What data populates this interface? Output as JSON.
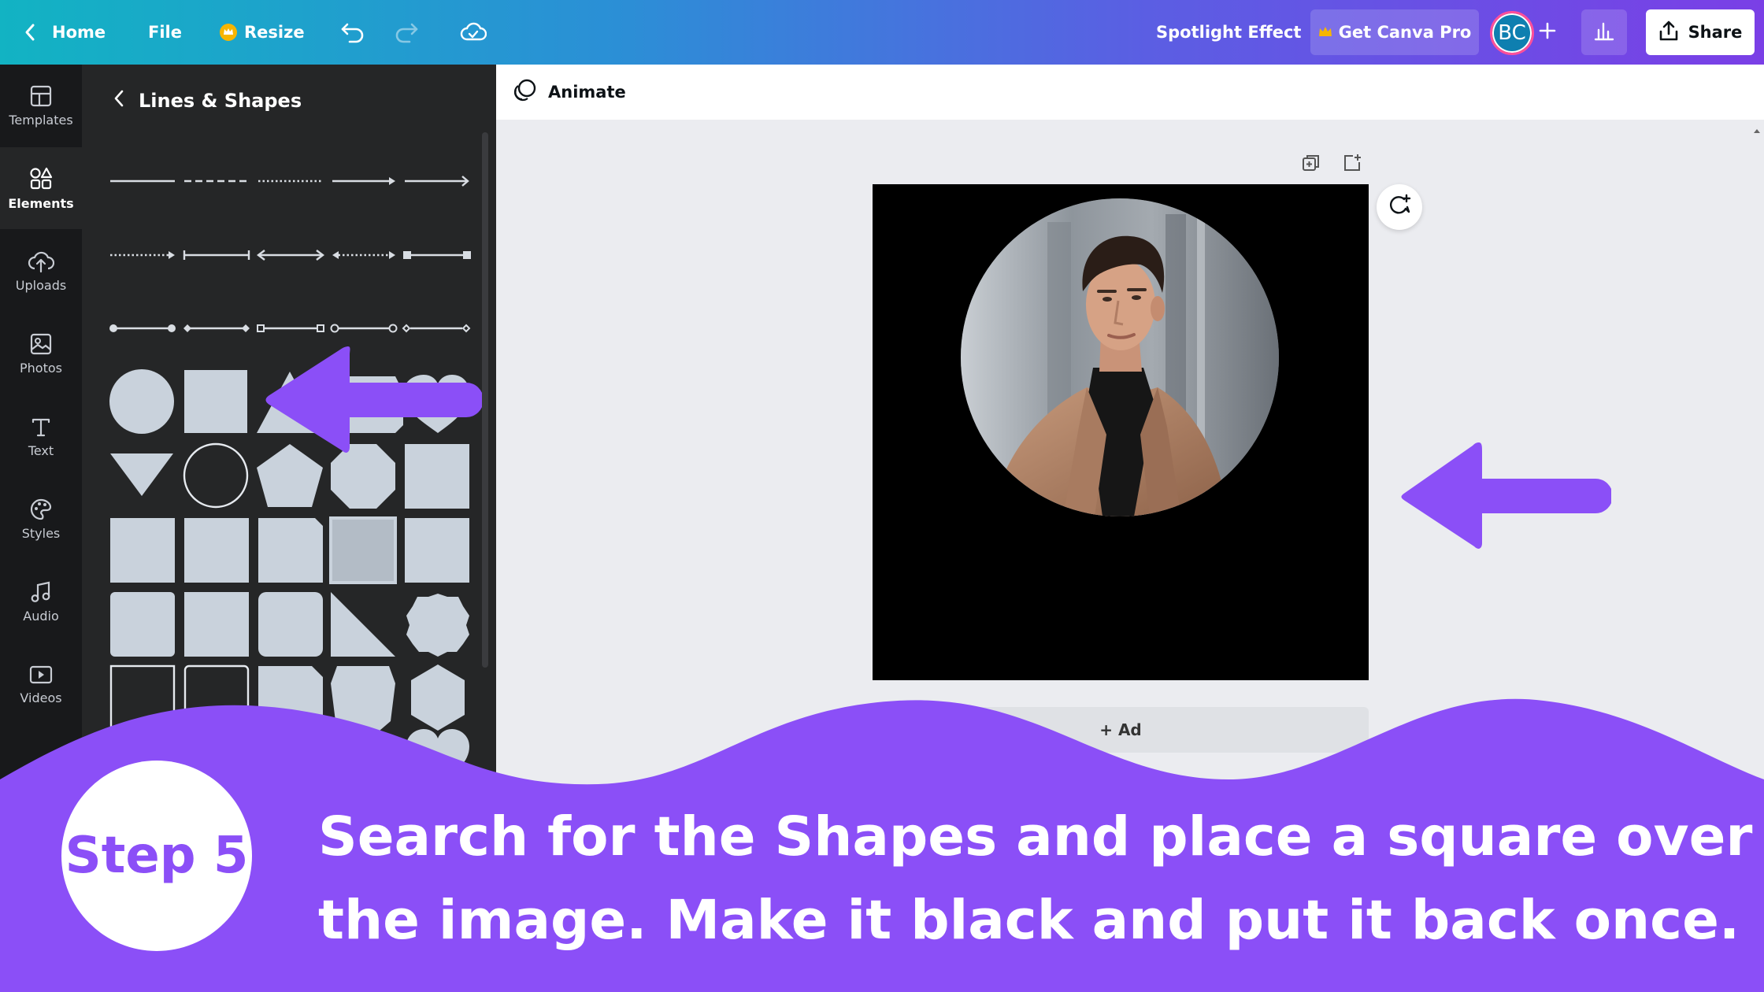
{
  "topbar": {
    "home_label": "Home",
    "file_label": "File",
    "resize_label": "Resize",
    "design_title": "Spotlight Effect",
    "get_pro_label": "Get Canva Pro",
    "avatar_initials": "BC",
    "share_label": "Share"
  },
  "rail": {
    "items": [
      {
        "label": "Templates",
        "icon": "templates-icon"
      },
      {
        "label": "Elements",
        "icon": "elements-icon"
      },
      {
        "label": "Uploads",
        "icon": "uploads-icon"
      },
      {
        "label": "Photos",
        "icon": "photos-icon"
      },
      {
        "label": "Text",
        "icon": "text-icon"
      },
      {
        "label": "Styles",
        "icon": "styles-icon"
      },
      {
        "label": "Audio",
        "icon": "audio-icon"
      },
      {
        "label": "Videos",
        "icon": "videos-icon"
      }
    ],
    "active": "Elements"
  },
  "panel": {
    "title": "Lines & Shapes"
  },
  "editor": {
    "animate_label": "Animate",
    "add_page_label": "+ Ad"
  },
  "overlay": {
    "step_label": "Step 5",
    "caption_line1": "Search for the Shapes and place a square over",
    "caption_line2": "the image. Make it black and put it back once."
  },
  "colors": {
    "accent_purple": "#8b4ff7",
    "shape_fill": "#c9d2dc",
    "panel_bg": "#252627",
    "rail_bg": "#18191b"
  }
}
